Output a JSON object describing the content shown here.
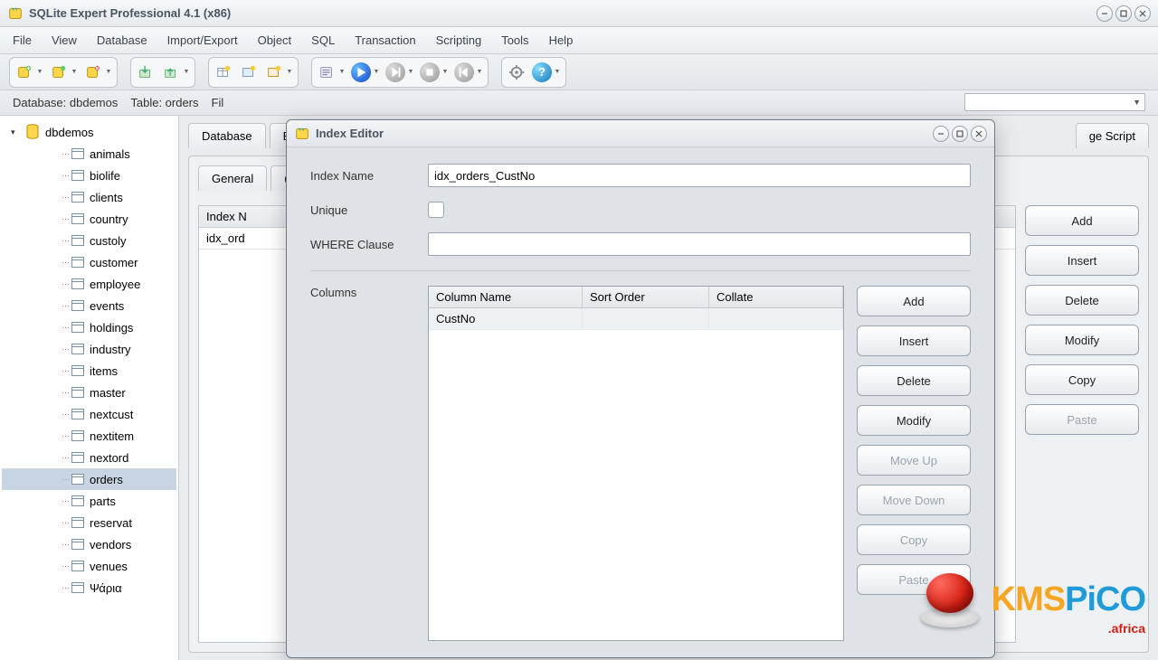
{
  "window": {
    "title": "SQLite Expert Professional 4.1 (x86)"
  },
  "menu": [
    "File",
    "View",
    "Database",
    "Import/Export",
    "Object",
    "SQL",
    "Transaction",
    "Scripting",
    "Tools",
    "Help"
  ],
  "dbinfo": {
    "database_label": "Database: dbdemos",
    "table_label": "Table: orders",
    "file_label": "Fil"
  },
  "tree": {
    "db": "dbdemos",
    "tables": [
      "animals",
      "biolife",
      "clients",
      "country",
      "custoly",
      "customer",
      "employee",
      "events",
      "holdings",
      "industry",
      "items",
      "master",
      "nextcust",
      "nextitem",
      "nextord",
      "orders",
      "parts",
      "reservat",
      "vendors",
      "venues",
      "Ψάρια"
    ],
    "selected": "orders"
  },
  "content": {
    "main_tabs": [
      "Database",
      "Ex"
    ],
    "sub_tabs": [
      "General",
      "("
    ],
    "right_tab": "ge Script",
    "index_header": "Index N",
    "index_row": "idx_ord",
    "side_buttons": [
      "Add",
      "Insert",
      "Delete",
      "Modify",
      "Copy",
      "Paste"
    ],
    "side_disabled": [
      "Paste"
    ]
  },
  "dialog": {
    "title": "Index Editor",
    "index_name_label": "Index Name",
    "index_name_value": "idx_orders_CustNo",
    "unique_label": "Unique",
    "where_label": "WHERE Clause",
    "where_value": "",
    "columns_label": "Columns",
    "col_headers": [
      "Column Name",
      "Sort Order",
      "Collate"
    ],
    "col_row": [
      "CustNo",
      "",
      ""
    ],
    "buttons": [
      "Add",
      "Insert",
      "Delete",
      "Modify",
      "Move Up",
      "Move Down",
      "Copy",
      "Paste"
    ],
    "disabled": [
      "Move Up",
      "Move Down",
      "Copy",
      "Paste"
    ]
  },
  "watermark": {
    "p1": "KMS",
    "p2": "PiCO",
    "sub": ".africa"
  }
}
